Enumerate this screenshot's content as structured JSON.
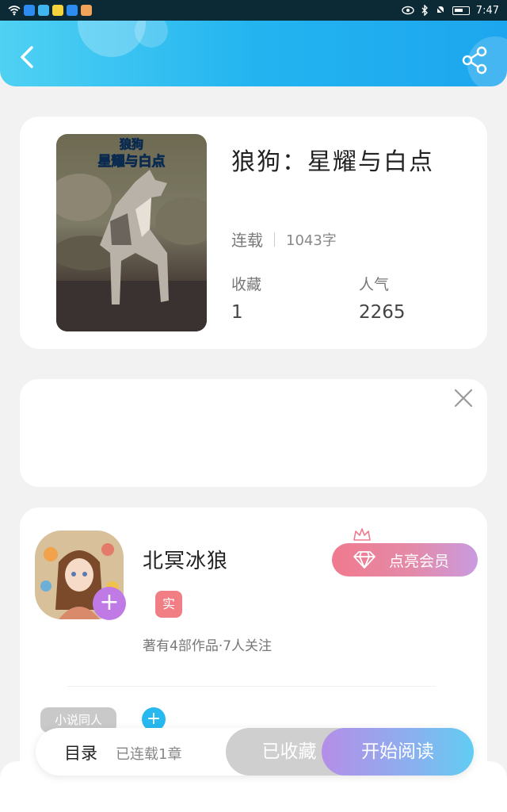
{
  "status_bar": {
    "time": "7:47"
  },
  "book": {
    "title": "狼狗：星耀与白点",
    "status": "连载",
    "word_count": "1043字",
    "favorites_label": "收藏",
    "favorites_value": "1",
    "popularity_label": "人气",
    "popularity_value": "2265",
    "cover_text": "狼狗 星耀与白点"
  },
  "author": {
    "name": "北冥冰狼",
    "verified_badge": "实",
    "meta": "著有4部作品·7人关注",
    "vip_button": "点亮会员",
    "tag": "小说同人"
  },
  "bottom_bar": {
    "toc_label": "目录",
    "toc_sub": "已连载1章",
    "collected_label": "已收藏",
    "read_label": "开始阅读"
  },
  "colors": {
    "header_accent": "#23b4f0",
    "vip_pink": "#f07a8e",
    "read_gradient_end": "#61cdf2",
    "avatar_plus": "#c07ae6"
  },
  "icons": [
    "back-arrow-icon",
    "share-icon",
    "close-icon",
    "diamond-icon",
    "crown-icon",
    "plus-icon"
  ]
}
